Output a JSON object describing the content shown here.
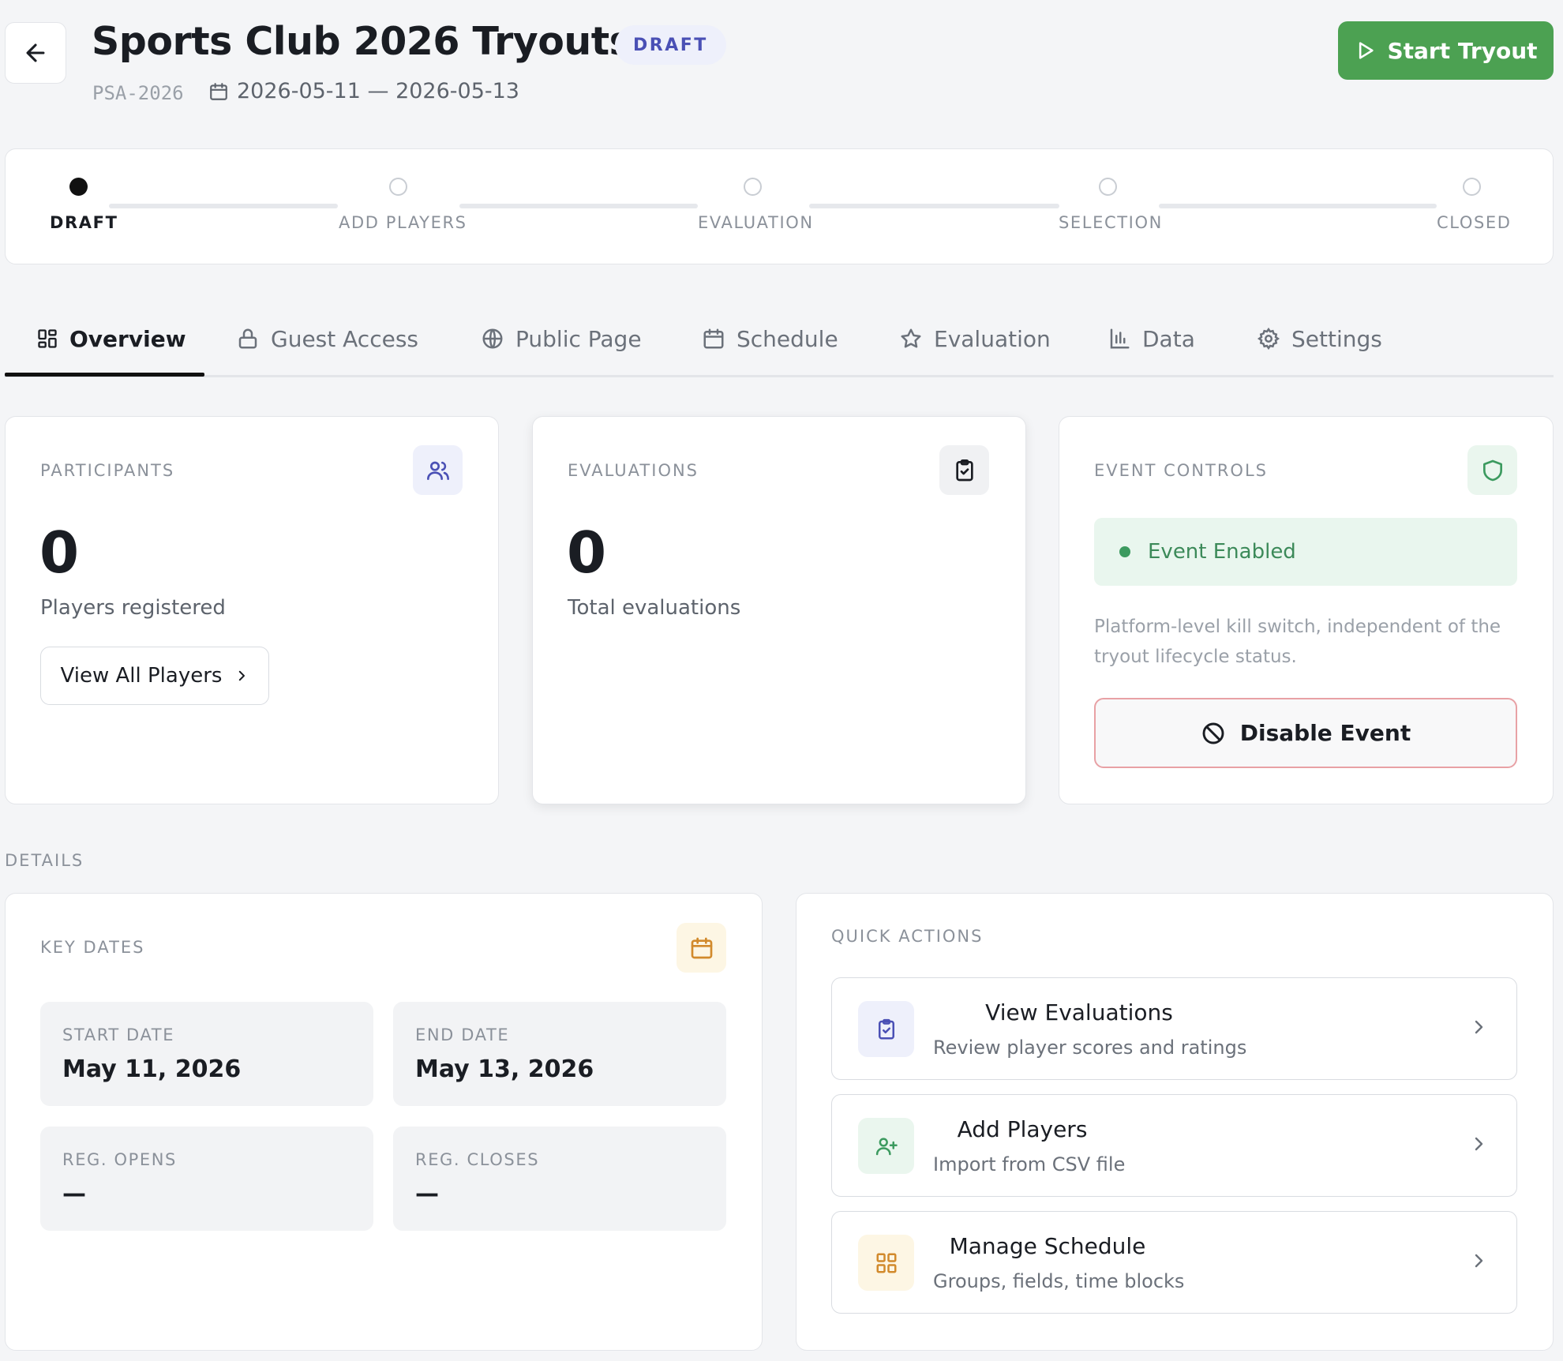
{
  "header": {
    "title": "Sports Club 2026 Tryouts",
    "status": "DRAFT",
    "code": "PSA-2026",
    "date_range": "2026-05-11 — 2026-05-13",
    "start_button": "Start Tryout"
  },
  "stepper": {
    "steps": [
      {
        "label": "DRAFT",
        "state": "current"
      },
      {
        "label": "ADD PLAYERS",
        "state": "pending"
      },
      {
        "label": "EVALUATION",
        "state": "pending"
      },
      {
        "label": "SELECTION",
        "state": "pending"
      },
      {
        "label": "CLOSED",
        "state": "pending"
      }
    ]
  },
  "tabs": [
    {
      "label": "Overview",
      "icon": "grid-icon",
      "active": true
    },
    {
      "label": "Guest Access",
      "icon": "lock-icon",
      "active": false
    },
    {
      "label": "Public Page",
      "icon": "globe-icon",
      "active": false
    },
    {
      "label": "Schedule",
      "icon": "calendar-icon",
      "active": false
    },
    {
      "label": "Evaluation",
      "icon": "star-icon",
      "active": false
    },
    {
      "label": "Data",
      "icon": "bar-chart-icon",
      "active": false
    },
    {
      "label": "Settings",
      "icon": "gear-icon",
      "active": false
    }
  ],
  "participants": {
    "label": "PARTICIPANTS",
    "count": "0",
    "subtitle": "Players registered",
    "button": "View All Players"
  },
  "evaluations": {
    "label": "EVALUATIONS",
    "count": "0",
    "subtitle": "Total evaluations"
  },
  "event_controls": {
    "label": "EVENT CONTROLS",
    "status": "Event Enabled",
    "note": "Platform-level kill switch, independent of the tryout lifecycle status.",
    "disable_button": "Disable Event"
  },
  "details": {
    "section_label": "DETAILS",
    "key_dates": {
      "label": "KEY DATES",
      "tiles": [
        {
          "label": "START DATE",
          "value": "May 11, 2026"
        },
        {
          "label": "END DATE",
          "value": "May 13, 2026"
        },
        {
          "label": "REG. OPENS",
          "value": "—"
        },
        {
          "label": "REG. CLOSES",
          "value": "—"
        }
      ]
    },
    "quick_actions": {
      "label": "QUICK ACTIONS",
      "items": [
        {
          "title": "View Evaluations",
          "description": "Review player scores and ratings",
          "icon": "clipboard-check-icon"
        },
        {
          "title": "Add Players",
          "description": "Import from CSV file",
          "icon": "user-plus-icon"
        },
        {
          "title": "Manage Schedule",
          "description": "Groups, fields, time blocks",
          "icon": "grid-icon"
        }
      ]
    }
  },
  "colors": {
    "accent_green": "#4ca152",
    "draft_pill_bg": "#eef0fb",
    "draft_pill_text": "#4a50b5",
    "enabled_bg": "#e9f6ee",
    "enabled_text": "#3c8a59",
    "danger_border": "#e8a1a5"
  }
}
